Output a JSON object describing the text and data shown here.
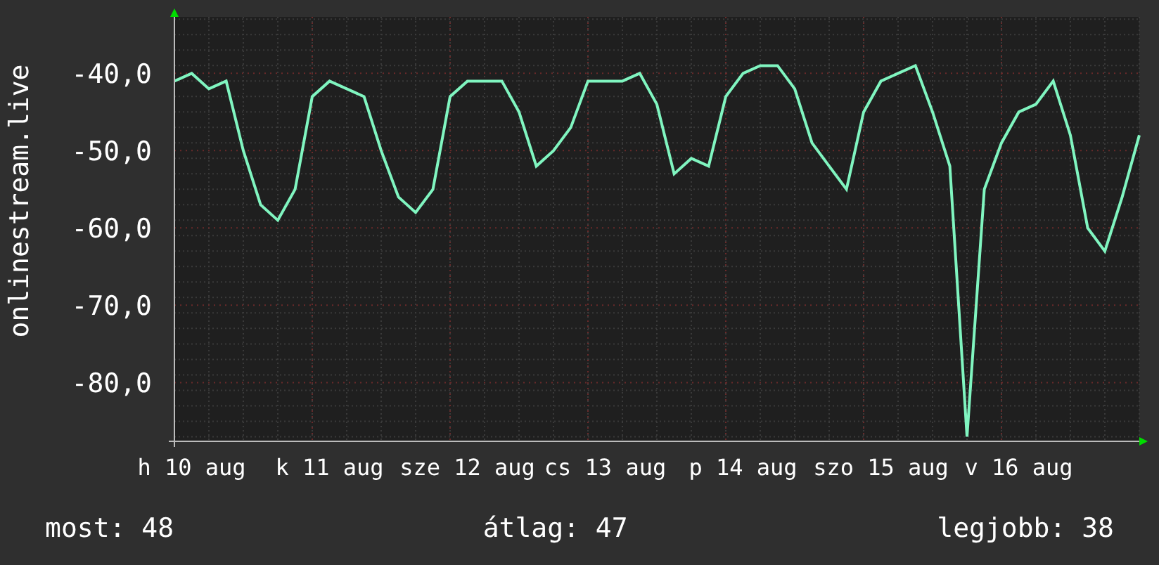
{
  "chart": {
    "chart_data": {
      "type": "line",
      "ylabel": "onlinestream.live",
      "categories": [
        null,
        "h 10 aug",
        null,
        null,
        null,
        null,
        null,
        null,
        null,
        "k 11 aug",
        null,
        null,
        null,
        null,
        null,
        null,
        null,
        "sze 12 aug",
        null,
        null,
        null,
        null,
        null,
        null,
        null,
        "cs 13 aug",
        null,
        null,
        null,
        null,
        null,
        null,
        null,
        "p 14 aug",
        null,
        null,
        null,
        null,
        null,
        null,
        null,
        "szo 15 aug",
        null,
        null,
        null,
        null,
        null,
        null,
        null,
        "v 16 aug",
        null,
        null,
        null,
        null,
        null,
        null,
        null
      ],
      "series": [
        {
          "color": "#80f5c0",
          "values": [
            -41,
            -40,
            -42,
            -41,
            -50,
            -57,
            -59,
            -55,
            -43,
            -41,
            -42,
            -43,
            -50,
            -56,
            -58,
            -55,
            -43,
            -41,
            -41,
            -41,
            -45,
            -52,
            -50,
            -47,
            -41,
            -41,
            -41,
            -40,
            -44,
            -53,
            -51,
            -52,
            -43,
            -40,
            -39,
            -39,
            -42,
            -49,
            -52,
            -55,
            -45,
            -41,
            -40,
            -39,
            -45,
            -52,
            -87,
            -55,
            -49,
            -45,
            -44,
            -41,
            -48,
            -60,
            -63,
            -56,
            -48
          ]
        }
      ],
      "grid": true,
      "ylim": [
        -87.6,
        -32.7
      ],
      "yticks": [
        {
          "value": -40,
          "label": "-40,0"
        },
        {
          "value": -50,
          "label": "-50,0"
        },
        {
          "value": -60,
          "label": "-60,0"
        },
        {
          "value": -70,
          "label": "-70,0"
        },
        {
          "value": -80,
          "label": "-80,0"
        }
      ]
    }
  },
  "stats": [
    {
      "text": "most: 48"
    },
    {
      "text": "átlag: 47"
    },
    {
      "text": "legjobb: 38"
    }
  ]
}
